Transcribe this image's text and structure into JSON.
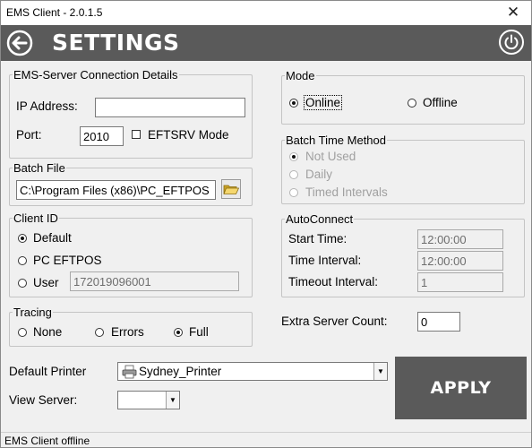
{
  "window": {
    "title": "EMS Client - 2.0.1.5",
    "close_glyph": "✕"
  },
  "header": {
    "title": "SETTINGS",
    "back_icon": "arrow-left-circle-icon",
    "power_icon": "power-icon",
    "bg_color": "#5a5a5a"
  },
  "connection": {
    "legend": "EMS-Server Connection Details",
    "ip_label": "IP Address:",
    "ip_value": "",
    "port_label": "Port:",
    "port_value": "2010",
    "eftsrv_label": "EFTSRV Mode",
    "eftsrv_checked": false
  },
  "batch_file": {
    "legend": "Batch File",
    "path": "C:\\Program Files (x86)\\PC_EFTPOS",
    "browse_icon": "folder-open-icon"
  },
  "client_id": {
    "legend": "Client ID",
    "options": [
      "Default",
      "PC EFTPOS",
      "User"
    ],
    "selected": "Default",
    "user_value": "172019096001"
  },
  "tracing": {
    "legend": "Tracing",
    "options": [
      "None",
      "Errors",
      "Full"
    ],
    "selected": "Full"
  },
  "mode": {
    "legend": "Mode",
    "options": [
      "Online",
      "Offline"
    ],
    "selected": "Online"
  },
  "batch_time": {
    "legend": "Batch Time Method",
    "options": [
      "Not Used",
      "Daily",
      "Timed Intervals"
    ],
    "selected": "Not Used",
    "disabled": true
  },
  "autoconnect": {
    "legend": "AutoConnect",
    "start_label": "Start Time:",
    "start_value": "12:00:00",
    "interval_label": "Time Interval:",
    "interval_value": "12:00:00",
    "timeout_label": "Timeout Interval:",
    "timeout_value": "1"
  },
  "extra": {
    "label": "Extra Server Count:",
    "value": "0"
  },
  "printer": {
    "label": "Default Printer",
    "value": "Sydney_Printer",
    "icon": "printer-icon"
  },
  "view_server": {
    "label": "View Server:",
    "value": ""
  },
  "apply_label": "APPLY",
  "status": "EMS Client offline"
}
